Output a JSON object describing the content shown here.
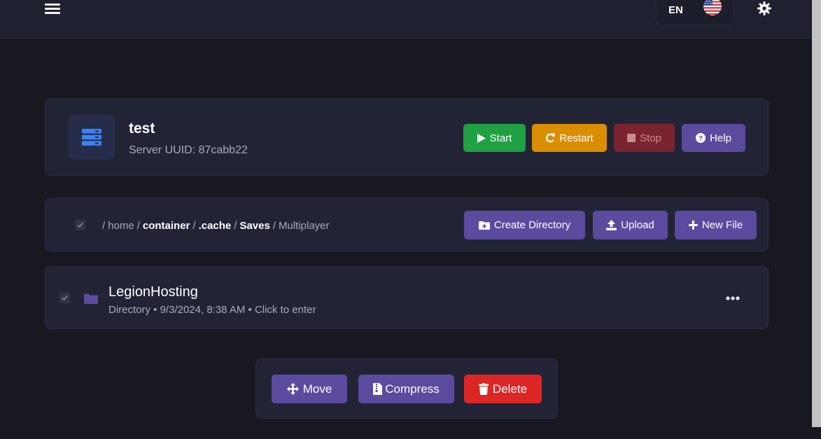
{
  "header": {
    "language_code": "EN",
    "flag_icon": "us-flag-icon",
    "menu_icon": "hamburger-menu-icon",
    "settings_icon": "gear-icon"
  },
  "server": {
    "name": "test",
    "uuid_text": "Server UUID: 87cabb22",
    "icon": "server-icon",
    "buttons": {
      "start": "Start",
      "restart": "Restart",
      "stop": "Stop",
      "help": "Help"
    }
  },
  "file_browser": {
    "breadcrumb": [
      {
        "label": "home",
        "bold": false
      },
      {
        "label": "container",
        "bold": true
      },
      {
        "label": ".cache",
        "bold": true
      },
      {
        "label": "Saves",
        "bold": true
      },
      {
        "label": "Multiplayer",
        "bold": false
      }
    ],
    "breadcrumb_separator": "/",
    "buttons": {
      "create_directory": "Create Directory",
      "upload": "Upload",
      "new_file": "New File"
    },
    "files": [
      {
        "name": "LegionHosting",
        "meta": "Directory • 9/3/2024, 8:38 AM • Click to enter",
        "icon": "folder-icon"
      }
    ]
  },
  "bulk_actions": {
    "move": "Move",
    "compress": "Compress",
    "delete": "Delete"
  },
  "colors": {
    "background": "#181920",
    "card": "#222436",
    "accent_purple": "#5c4a9e",
    "start_green": "#1fa144",
    "restart_orange": "#d98e04",
    "stop_red": "#7a2430",
    "delete_red": "#dc2626"
  }
}
